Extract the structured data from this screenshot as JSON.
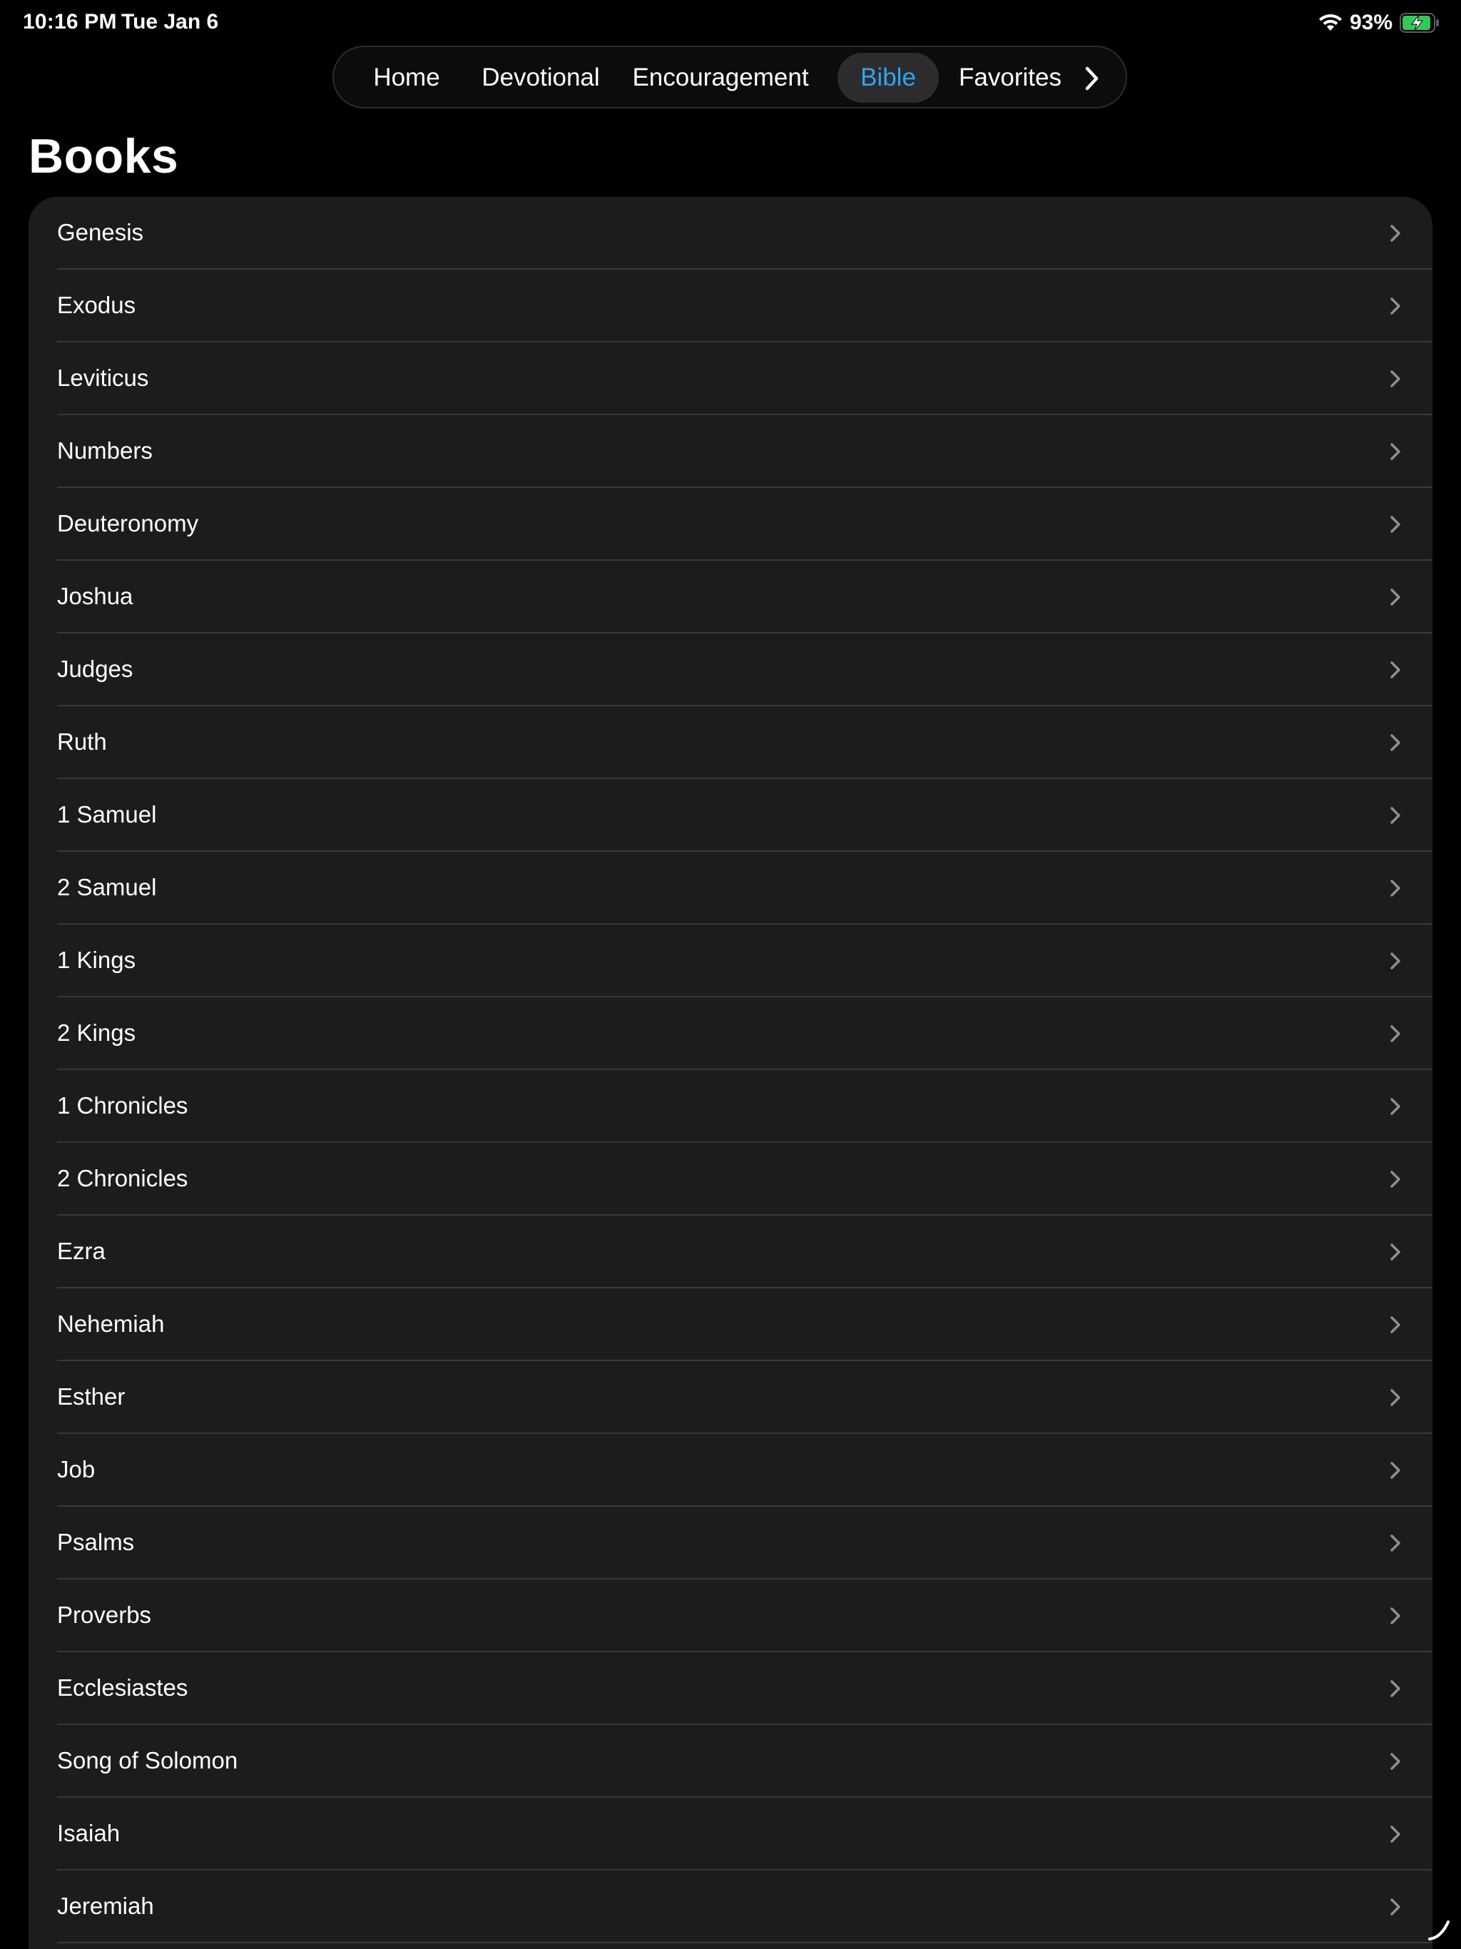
{
  "status_bar": {
    "time": "10:16 PM",
    "date": "Tue Jan 6",
    "battery_percent": "93%",
    "battery_level": 0.93,
    "charging": true,
    "icons": [
      "wifi-icon",
      "battery-charging-icon"
    ]
  },
  "nav": {
    "items": [
      {
        "label": "Home",
        "active": false
      },
      {
        "label": "Devotional",
        "active": false
      },
      {
        "label": "Encouragement",
        "active": false
      },
      {
        "label": "Bible",
        "active": true
      },
      {
        "label": "Favorites",
        "active": false
      }
    ],
    "more_icon": "chevron-right-icon"
  },
  "page": {
    "title": "Books"
  },
  "books": [
    {
      "label": "Genesis"
    },
    {
      "label": "Exodus"
    },
    {
      "label": "Leviticus"
    },
    {
      "label": "Numbers"
    },
    {
      "label": "Deuteronomy"
    },
    {
      "label": "Joshua"
    },
    {
      "label": "Judges"
    },
    {
      "label": "Ruth"
    },
    {
      "label": "1 Samuel"
    },
    {
      "label": "2 Samuel"
    },
    {
      "label": "1 Kings"
    },
    {
      "label": "2 Kings"
    },
    {
      "label": "1 Chronicles"
    },
    {
      "label": "2 Chronicles"
    },
    {
      "label": "Ezra"
    },
    {
      "label": "Nehemiah"
    },
    {
      "label": "Esther"
    },
    {
      "label": "Job"
    },
    {
      "label": "Psalms"
    },
    {
      "label": "Proverbs"
    },
    {
      "label": "Ecclesiastes"
    },
    {
      "label": "Song of Solomon"
    },
    {
      "label": "Isaiah"
    },
    {
      "label": "Jeremiah"
    }
  ],
  "colors": {
    "background": "#000000",
    "card": "#1c1c1e",
    "separator": "#38383a",
    "accent": "#30a4f0",
    "chevron": "#8e8e93",
    "battery": "#34c759"
  }
}
